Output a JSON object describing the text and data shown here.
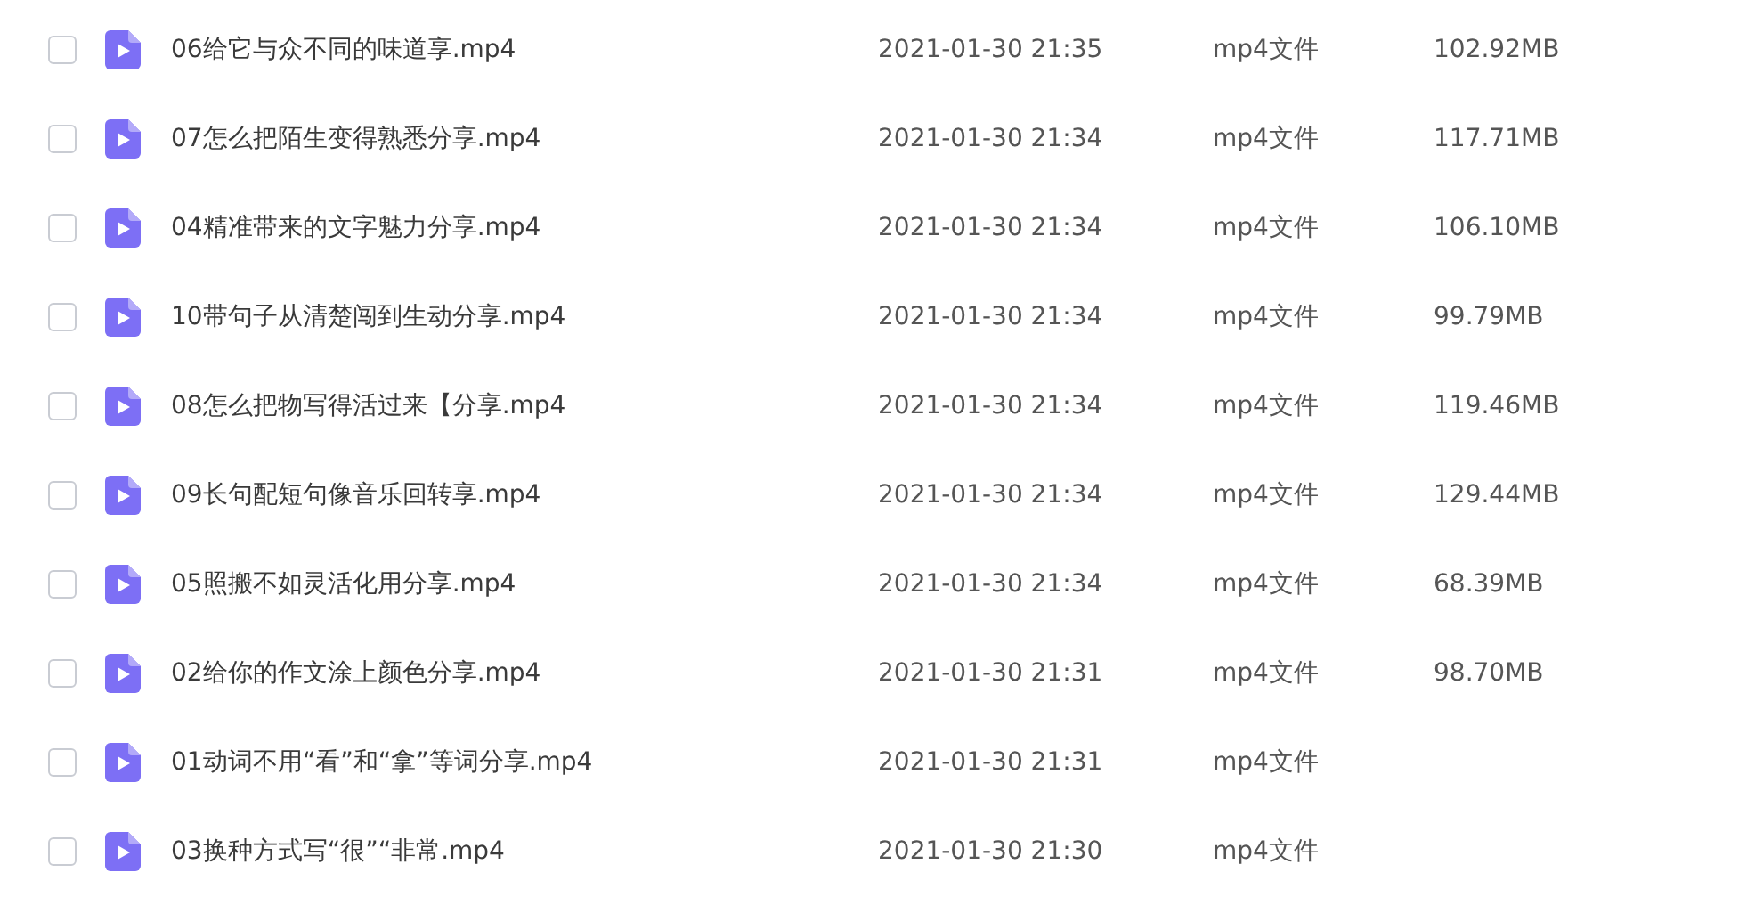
{
  "files": [
    {
      "name": "06给它与众不同的味道享.mp4",
      "date": "2021-01-30 21:35",
      "type": "mp4文件",
      "size": "102.92MB",
      "checked": false
    },
    {
      "name": "07怎么把陌生变得熟悉分享.mp4",
      "date": "2021-01-30 21:34",
      "type": "mp4文件",
      "size": "117.71MB",
      "checked": false
    },
    {
      "name": "04精准带来的文字魅力分享.mp4",
      "date": "2021-01-30 21:34",
      "type": "mp4文件",
      "size": "106.10MB",
      "checked": false
    },
    {
      "name": "10带句子从清楚闯到生动分享.mp4",
      "date": "2021-01-30 21:34",
      "type": "mp4文件",
      "size": "99.79MB",
      "checked": false
    },
    {
      "name": "08怎么把物写得活过来【分享.mp4",
      "date": "2021-01-30 21:34",
      "type": "mp4文件",
      "size": "119.46MB",
      "checked": false
    },
    {
      "name": "09长句配短句像音乐回转享.mp4",
      "date": "2021-01-30 21:34",
      "type": "mp4文件",
      "size": "129.44MB",
      "checked": false
    },
    {
      "name": "05照搬不如灵活化用分享.mp4",
      "date": "2021-01-30 21:34",
      "type": "mp4文件",
      "size": "68.39MB",
      "checked": false
    },
    {
      "name": "02给你的作文涂上颜色分享.mp4",
      "date": "2021-01-30 21:31",
      "type": "mp4文件",
      "size": "98.70MB",
      "checked": false
    },
    {
      "name": "01动词不用“看”和“拿”等词分享.mp4",
      "date": "2021-01-30 21:31",
      "type": "mp4文件",
      "checked": false
    },
    {
      "name": "03换种方式写“很”“非常.mp4",
      "date": "2021-01-30 21:30",
      "type": "mp4文件",
      "checked": false
    }
  ]
}
